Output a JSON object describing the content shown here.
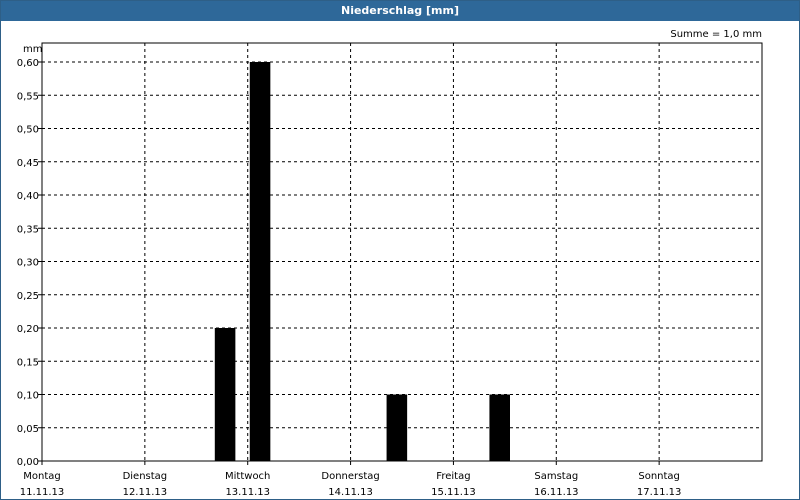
{
  "window": {
    "title": "Niederschlag [mm]"
  },
  "chart_data": {
    "type": "bar",
    "title": "Niederschlag [mm]",
    "ylabel": "mm",
    "ylim": [
      0,
      0.6
    ],
    "yticks": [
      "0,00",
      "0,05",
      "0,10",
      "0,15",
      "0,20",
      "0,25",
      "0,30",
      "0,35",
      "0,40",
      "0,45",
      "0,50",
      "0,55",
      "0,60"
    ],
    "summary": "Summe = 1,0 mm",
    "xlim_days": [
      0,
      7
    ],
    "days": [
      {
        "name": "Montag",
        "date": "11.11.13"
      },
      {
        "name": "Dienstag",
        "date": "12.11.13"
      },
      {
        "name": "Mittwoch",
        "date": "13.11.13"
      },
      {
        "name": "Donnerstag",
        "date": "14.11.13"
      },
      {
        "name": "Freitag",
        "date": "15.11.13"
      },
      {
        "name": "Samstag",
        "date": "16.11.13"
      },
      {
        "name": "Sonntag",
        "date": "17.11.13"
      }
    ],
    "bars": [
      {
        "day_start": 1.68,
        "day_end": 1.88,
        "value": 0.2
      },
      {
        "day_start": 2.02,
        "day_end": 2.22,
        "value": 0.6
      },
      {
        "day_start": 3.35,
        "day_end": 3.55,
        "value": 0.1
      },
      {
        "day_start": 4.35,
        "day_end": 4.55,
        "value": 0.1
      }
    ],
    "grid": true,
    "bar_color": "#000000"
  }
}
